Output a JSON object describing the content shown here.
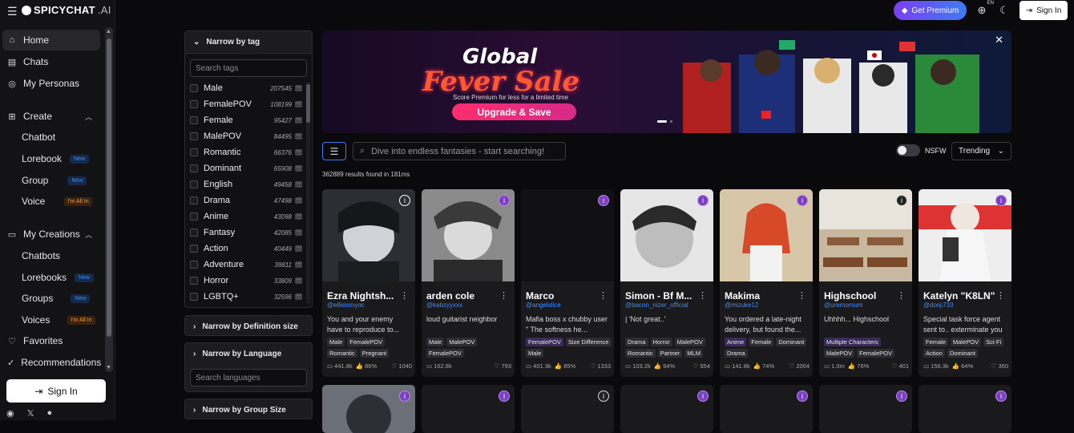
{
  "app": {
    "logo_main": "SPICYCHAT",
    "logo_suffix": ".AI"
  },
  "header": {
    "premium_label": "Get Premium",
    "lang_badge": "EN",
    "signin_label": "Sign In"
  },
  "sidebar": {
    "home": "Home",
    "chats": "Chats",
    "personas": "My Personas",
    "create": "Create",
    "chatbot": "Chatbot",
    "lorebook": "Lorebook",
    "group": "Group",
    "voice": "Voice",
    "my_creations": "My Creations",
    "chatbots": "Chatbots",
    "lorebooks": "Lorebooks",
    "groups": "Groups",
    "voices": "Voices",
    "favorites": "Favorites",
    "recommendations": "Recommendations",
    "badge_new": "New",
    "badge_all": "I'm All In",
    "signin": "Sign In"
  },
  "filters": {
    "narrow_tag": "Narrow by tag",
    "search_tags_placeholder": "Search tags",
    "tags": [
      {
        "name": "Male",
        "count": "207545"
      },
      {
        "name": "FemalePOV",
        "count": "108199"
      },
      {
        "name": "Female",
        "count": "95427"
      },
      {
        "name": "MalePOV",
        "count": "84495"
      },
      {
        "name": "Romantic",
        "count": "66376"
      },
      {
        "name": "Dominant",
        "count": "65908"
      },
      {
        "name": "English",
        "count": "49458"
      },
      {
        "name": "Drama",
        "count": "47498"
      },
      {
        "name": "Anime",
        "count": "43098"
      },
      {
        "name": "Fantasy",
        "count": "42085"
      },
      {
        "name": "Action",
        "count": "40449"
      },
      {
        "name": "Adventure",
        "count": "39811"
      },
      {
        "name": "Horror",
        "count": "33809"
      },
      {
        "name": "LGBTQ+",
        "count": "32596"
      }
    ],
    "narrow_def": "Narrow by Definition size",
    "narrow_lang": "Narrow by Language",
    "search_lang_placeholder": "Search languages",
    "narrow_group": "Narrow by Group Size"
  },
  "banner": {
    "title1": "Global",
    "title2": "Fever Sale",
    "subtitle": "Score Premium for less for a limited time",
    "cta": "Upgrade & Save"
  },
  "search": {
    "placeholder": "Dive into endless fantasies - start searching!",
    "results": "362889 results found in 181ms",
    "nsfw_label": "NSFW",
    "sort_label": "Trending"
  },
  "cards": [
    {
      "name": "Ezra Nightsh...",
      "user": "@ellisismyoc",
      "desc": "You and your enemy have to reproduce to...",
      "tags": [
        "Male",
        "FemalePOV",
        "Romantic",
        "Pregnant"
      ],
      "chats": "441.8k",
      "rating": "86%",
      "msgs": "1040"
    },
    {
      "name": "arden cole",
      "user": "@kabzyyxxx",
      "desc": "loud guitarist neighbor",
      "tags": [
        "Male",
        "MalePOV",
        "FemalePOV"
      ],
      "chats": "162.8k",
      "rating": "",
      "msgs": "793"
    },
    {
      "name": "Marco",
      "user": "@angelslice",
      "desc": "Mafia boss x chubby user \" The softness he...",
      "tags": [
        "FemalePOV",
        "Size Difference",
        "Male"
      ],
      "chats": "401.3k",
      "rating": "85%",
      "msgs": "1333"
    },
    {
      "name": "Simon - Bf M...",
      "user": "@bacon_nizer_official",
      "desc": "| 'Not great..'",
      "tags": [
        "Drama",
        "Horror",
        "MalePOV",
        "Romantic",
        "Partner",
        "MLM"
      ],
      "chats": "103.2k",
      "rating": "94%",
      "msgs": "554"
    },
    {
      "name": "Makima",
      "user": "@mizuke12",
      "desc": "You ordered a late-night delivery, but found the...",
      "tags": [
        "Anime",
        "Female",
        "Dominant",
        "Drama"
      ],
      "chats": "141.8k",
      "rating": "74%",
      "msgs": "2004"
    },
    {
      "name": "Highschool",
      "user": "@uremomum",
      "desc": "Uhhhh... Highschool",
      "tags": [
        "Multiple Characters",
        "MalePOV",
        "FemalePOV"
      ],
      "chats": "1.0m",
      "rating": "76%",
      "msgs": "401"
    },
    {
      "name": "Katelyn \"K8LN\"",
      "user": "@dorp733",
      "desc": "Special task force agent sent to.. exterminate you",
      "tags": [
        "Female",
        "MalePOV",
        "Sci-Fi",
        "Action",
        "Dominant"
      ],
      "chats": "156.3k",
      "rating": "64%",
      "msgs": "350"
    }
  ]
}
